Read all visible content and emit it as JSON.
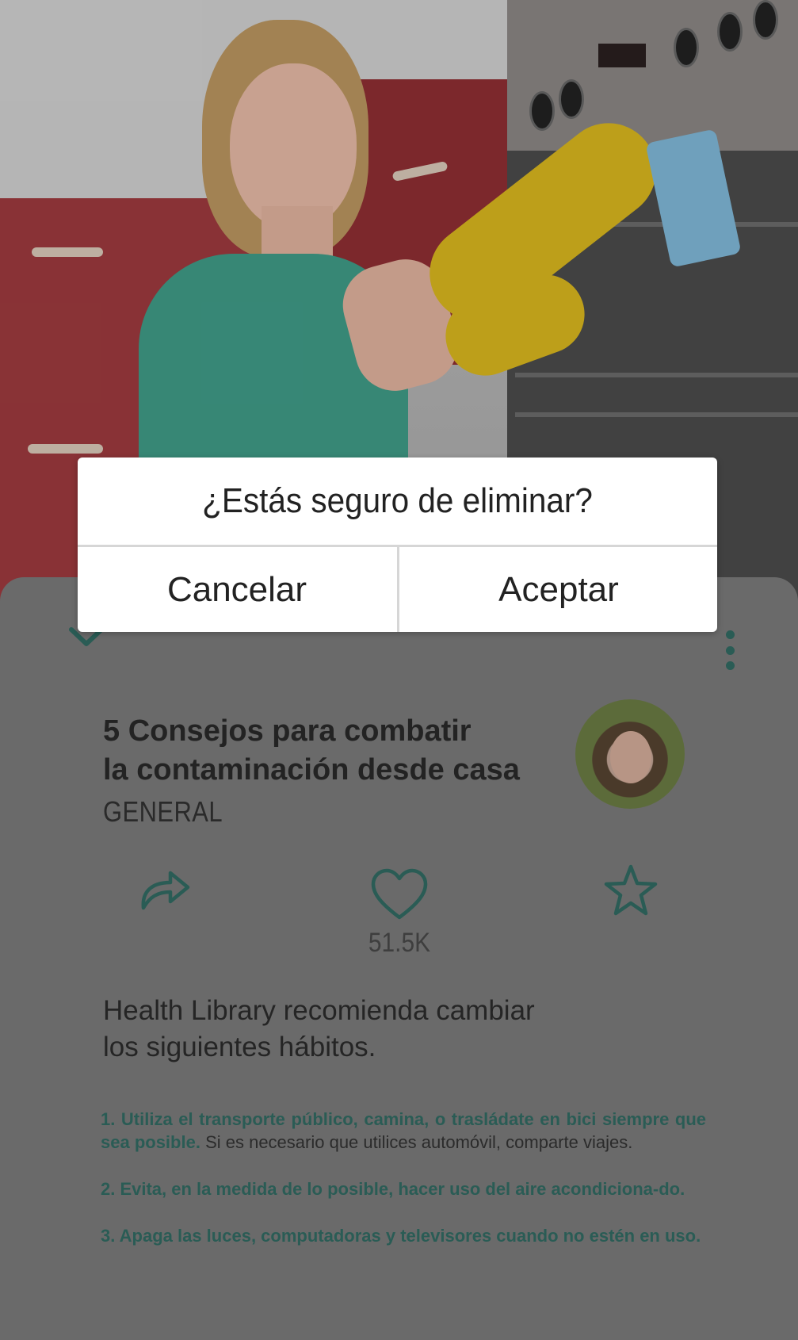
{
  "dialog": {
    "message": "¿Estás seguro de eliminar?",
    "cancel_label": "Cancelar",
    "accept_label": "Aceptar"
  },
  "article": {
    "title_lines": [
      "5 Consejos para combatir",
      "la contaminación desde casa"
    ],
    "category": "GENERAL",
    "likes": "51.5K",
    "intro_lines": [
      "Health Library recomienda cambiar",
      "los siguientes hábitos."
    ],
    "tips": [
      {
        "highlight": "1. Utiliza el transporte público, camina, o trasládate en bici siempre que sea posible.",
        "rest": " Si es necesario que utilices automóvil, comparte viajes."
      },
      {
        "highlight": "2. Evita, en la medida de lo posible, hacer uso del aire acondiciona-do.",
        "rest": ""
      },
      {
        "highlight": "3. Apaga las luces, computadoras y televisores cuando no estén en uso.",
        "rest": ""
      }
    ]
  },
  "icons": {
    "collapse": "chevron-down-icon",
    "menu": "more-vertical-icon",
    "share": "share-icon",
    "like": "heart-icon",
    "favorite": "star-icon"
  },
  "colors": {
    "accent": "#2a5c55",
    "overlay_background": "#6a6a6a",
    "dialog_background": "#ffffff"
  }
}
